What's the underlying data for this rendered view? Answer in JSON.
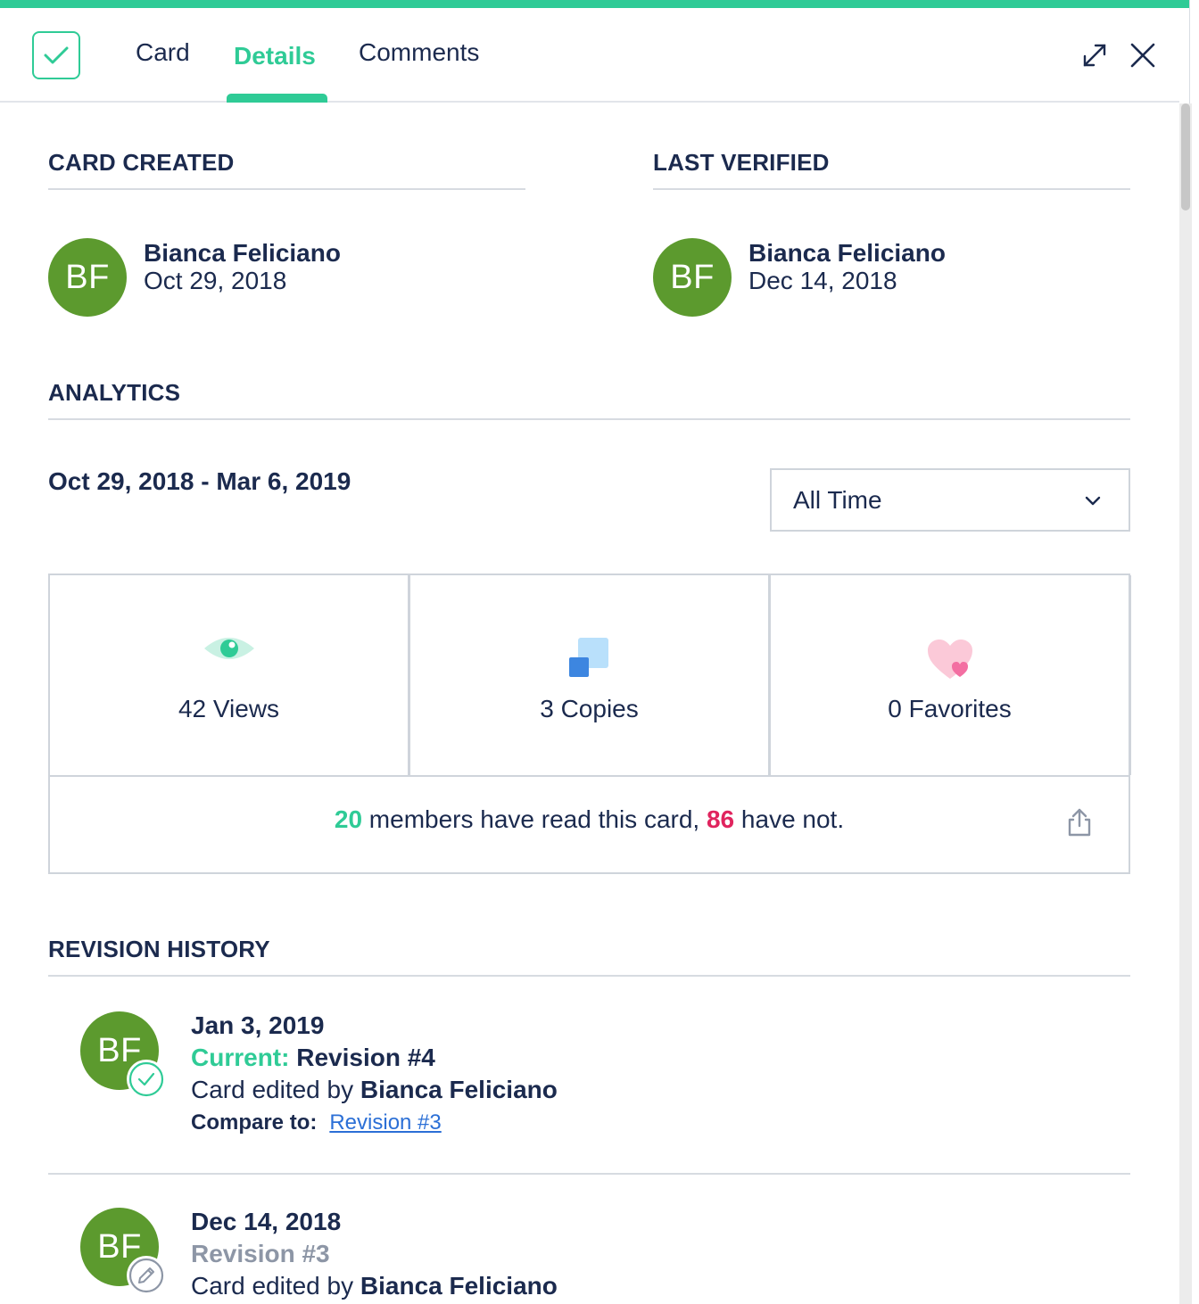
{
  "header": {
    "tabs": [
      {
        "label": "Card",
        "active": false
      },
      {
        "label": "Details",
        "active": true
      },
      {
        "label": "Comments",
        "active": false
      }
    ]
  },
  "card_created": {
    "title": "CARD CREATED",
    "initials": "BF",
    "name": "Bianca Feliciano",
    "date": "Oct 29, 2018"
  },
  "last_verified": {
    "title": "LAST VERIFIED",
    "initials": "BF",
    "name": "Bianca Feliciano",
    "date": "Dec 14, 2018"
  },
  "analytics": {
    "title": "ANALYTICS",
    "date_range": "Oct 29, 2018 - Mar 6, 2019",
    "period_select": "All Time",
    "stats": [
      {
        "label": "42 Views",
        "icon": "eye-icon"
      },
      {
        "label": "3 Copies",
        "icon": "copies-icon"
      },
      {
        "label": "0 Favorites",
        "icon": "heart-icon"
      }
    ],
    "read": {
      "read_count": "20",
      "middle_text": " members have read this card, ",
      "unread_count": "86",
      "end_text": " have not."
    }
  },
  "revision_history": {
    "title": "REVISION HISTORY",
    "items": [
      {
        "initials": "BF",
        "date": "Jan 3, 2019",
        "status_prefix": "Current:",
        "revision": "Revision #4",
        "edited_prefix": "Card edited by",
        "editor": "Bianca Feliciano",
        "compare_label": "Compare to:",
        "compare_link": "Revision #3",
        "badge": "check-icon"
      },
      {
        "initials": "BF",
        "date": "Dec 14, 2018",
        "revision": "Revision #3",
        "edited_prefix": "Card edited by",
        "editor": "Bianca Feliciano",
        "badge": "pencil-icon"
      }
    ]
  },
  "colors": {
    "accent": "#2fcb96",
    "avatar": "#5c9a2e",
    "navy": "#1b2a4e",
    "unread": "#e0245e",
    "link": "#2b6fd6"
  }
}
